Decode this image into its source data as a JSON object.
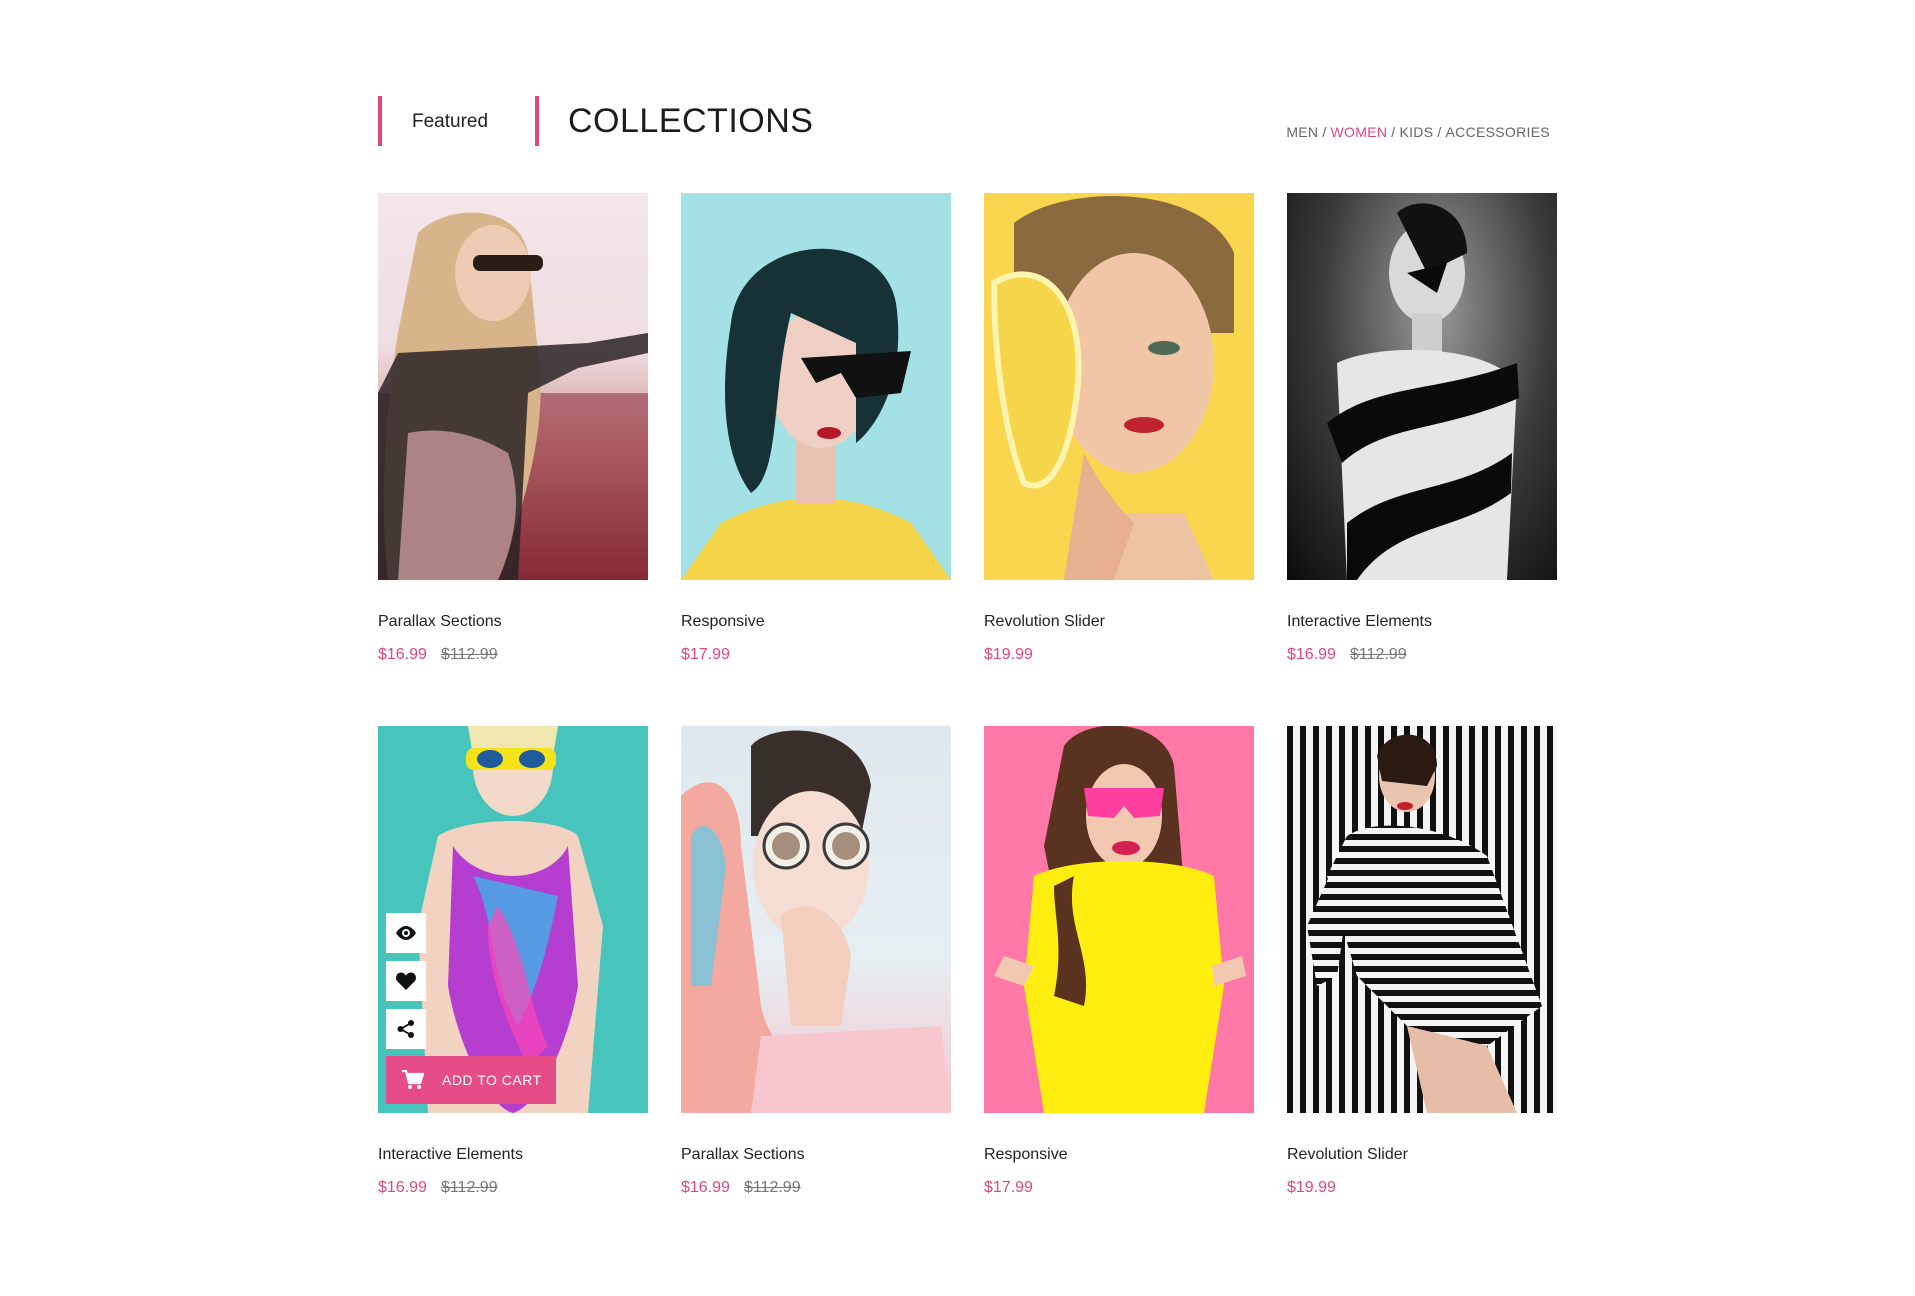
{
  "header": {
    "featured": "Featured",
    "title": "COLLECTIONS",
    "filters": [
      "MEN",
      "WOMEN",
      "KIDS",
      "ACCESSORIES"
    ],
    "active_filter": "WOMEN",
    "accent_color": "#e0467f"
  },
  "products": [
    {
      "name": "Parallax Sections",
      "price": "$16.99",
      "old_price": "$112.99"
    },
    {
      "name": "Responsive",
      "price": "$17.99",
      "old_price": ""
    },
    {
      "name": "Revolution Slider",
      "price": "$19.99",
      "old_price": ""
    },
    {
      "name": "Interactive Elements",
      "price": "$16.99",
      "old_price": "$112.99"
    },
    {
      "name": "Interactive Elements",
      "price": "$16.99",
      "old_price": "$112.99"
    },
    {
      "name": "Parallax Sections",
      "price": "$16.99",
      "old_price": "$112.99"
    },
    {
      "name": "Responsive",
      "price": "$17.99",
      "old_price": ""
    },
    {
      "name": "Revolution Slider",
      "price": "$19.99",
      "old_price": ""
    }
  ],
  "hover_actions": {
    "icons": [
      "eye-icon",
      "heart-icon",
      "share-icon",
      "cart-icon"
    ],
    "add_to_cart": "ADD TO CART"
  }
}
